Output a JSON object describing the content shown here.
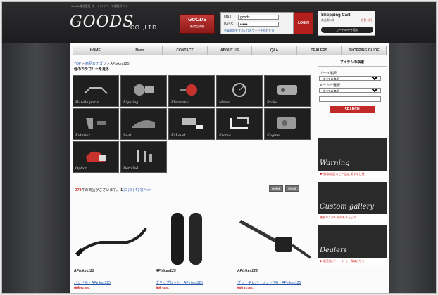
{
  "header": {
    "tagline": "Goods株式会社 オートバイパーツ通販サイト",
    "logo_text": "GOODS",
    "logo_suffix": "CO.,LTD",
    "promo": {
      "big": "GOODS",
      "small": "新商品情報"
    },
    "login": {
      "mail_label": "MAIL",
      "mail_value": "goods",
      "pass_label": "PASS",
      "pass_value": "••••••",
      "links": "会員登録をする / パスワードを忘れた方",
      "button": "LOGIN"
    },
    "cart": {
      "title": "Shopping Cart",
      "info": "商品数:0点",
      "total": "合計:0円",
      "button": "カートの中を見る"
    }
  },
  "nav": {
    "items": [
      "HOME",
      "News",
      "CONTACT",
      "ABOUT US",
      "Q&A",
      "DEALERS",
      "SHOPPING GUIDE"
    ]
  },
  "breadcrumb": {
    "top": "TOP",
    "sep1": " > ",
    "cat": "商品カテゴリ",
    "sep2": " > ",
    "current": "APtrikes125"
  },
  "category_heading": "他のカテゴリーを見る",
  "categories": [
    {
      "label": "Handle parts",
      "icon": "handlebar-icon"
    },
    {
      "label": "Lighting",
      "icon": "headlight-icon"
    },
    {
      "label": "Electronic",
      "icon": "electronic-icon"
    },
    {
      "label": "Meter",
      "icon": "meter-icon"
    },
    {
      "label": "Brake",
      "icon": "brake-caliper-icon"
    },
    {
      "label": "Exterior",
      "icon": "exterior-icon"
    },
    {
      "label": "Seat",
      "icon": "seat-icon"
    },
    {
      "label": "Exhaust",
      "icon": "exhaust-icon"
    },
    {
      "label": "Frame",
      "icon": "frame-icon"
    },
    {
      "label": "Engine",
      "icon": "engine-icon"
    },
    {
      "label": "Option",
      "icon": "option-icon"
    },
    {
      "label": "Detailed",
      "icon": "bolts-icon"
    }
  ],
  "listing": {
    "count_number": "378",
    "count_text": "件の商品がございます。",
    "pager_current": "1",
    "pager_links": "| 2 | 3 | 4 | 次へ>>",
    "sort_buttons": [
      "価格順",
      "新着順"
    ]
  },
  "products": [
    {
      "name": "ハンドル・APtrikes125",
      "price": "価格 ¥2,500-"
    },
    {
      "name": "グリップセット・APtrikes125",
      "price": "価格 ¥800-"
    },
    {
      "name": "ブレーキレバーセット(右)・APtrikes125",
      "price": "価格 ¥3,000-"
    }
  ],
  "product_brand": "APtrikes125",
  "sidebar": {
    "search_title": "アイテムの検索",
    "parts_label": "パーツ選択",
    "parts_value": "すべての商品",
    "maker_label": "メーカー選択",
    "maker_value": "すべての商品",
    "search_button": "SEARCH",
    "banners": [
      {
        "title": "Warning",
        "sub": "▶ 偽物商品(コピー品)に関する注意"
      },
      {
        "title": "Custom gallery",
        "sub": "最新カスタム車両をチェック"
      },
      {
        "title": "Dealers",
        "sub": "▶ 販売店(ディーラー)一覧はこちら"
      }
    ]
  },
  "colors": {
    "accent_red": "#c22a28",
    "link_blue": "#2255aa",
    "frame_dark": "#3a3b3e"
  }
}
